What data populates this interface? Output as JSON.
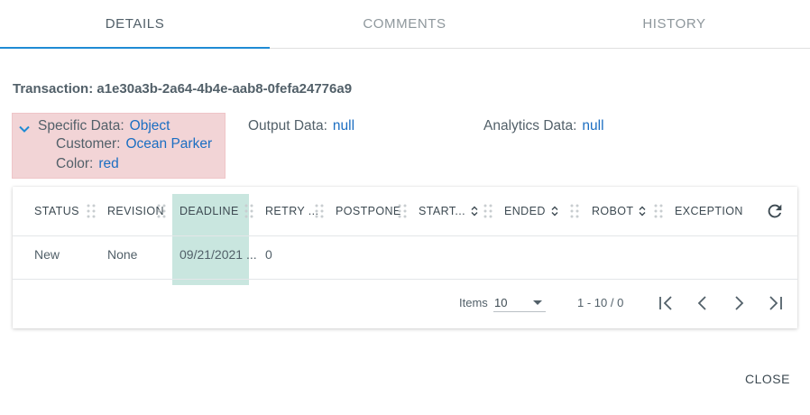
{
  "tabs": [
    {
      "label": "DETAILS"
    },
    {
      "label": "COMMENTS"
    },
    {
      "label": "HISTORY"
    }
  ],
  "transaction": {
    "label": "Transaction: a1e30a3b-2a64-4b4e-aab8-0fefa24776a9"
  },
  "specific_data": {
    "label": "Specific Data:",
    "value": "Object",
    "customer_label": "Customer:",
    "customer_value": "Ocean Parker",
    "color_label": "Color:",
    "color_value": "red"
  },
  "output_data": {
    "label": "Output Data:",
    "value": "null"
  },
  "analytics_data": {
    "label": "Analytics Data:",
    "value": "null"
  },
  "grid": {
    "columns": [
      "STATUS",
      "REVISION",
      "DEADLINE",
      "RETRY ...",
      "POSTPONE",
      "START...",
      "ENDED",
      "ROBOT",
      "EXCEPTION"
    ],
    "row": {
      "status": "New",
      "revision": "None",
      "deadline": "09/21/2021 ...",
      "retry": "0"
    }
  },
  "pager": {
    "items_label": "Items",
    "page_size": "10",
    "range": "1 - 10 / 0"
  },
  "close_label": "CLOSE",
  "colors": {
    "accent": "#1f8bd4",
    "link": "#1b6ec2",
    "highlight_red": "#f2d4d6",
    "highlight_green": "#c9e6df"
  }
}
